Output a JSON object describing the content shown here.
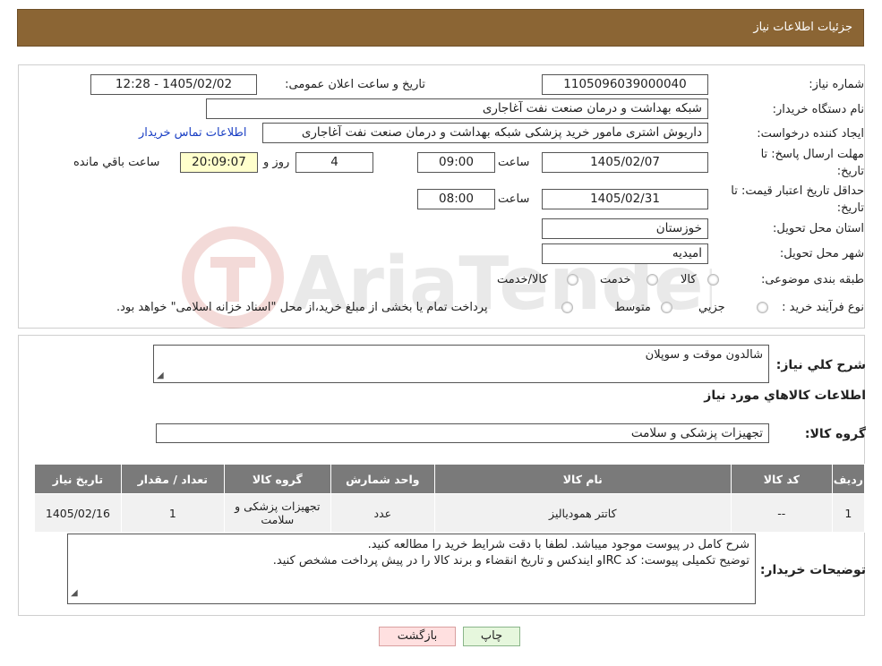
{
  "header": {
    "title": "جزئیات اطلاعات نیاز"
  },
  "fields": {
    "need_number_label": "شماره نیاز:",
    "need_number": "1105096039000040",
    "announce_label": "تاریخ و ساعت اعلان عمومی:",
    "announce_value": "1405/02/02 - 12:28",
    "buyer_org_label": "نام دستگاه خریدار:",
    "buyer_org": "شبکه بهداشت و درمان صنعت نفت آغاجاری",
    "requester_label": "ایجاد کننده درخواست:",
    "requester": "داریوش اشتری مامور خرید پزشکی شبکه بهداشت و درمان صنعت نفت آغاجاری",
    "contact_link": "اطلاعات تماس خریدار",
    "deadline_label_1": "مهلت ارسال پاسخ: تا",
    "deadline_label_2": "تاریخ:",
    "deadline_date": "1405/02/07",
    "time_label": "ساعت",
    "deadline_time": "09:00",
    "days_value": "4",
    "days_label": "روز و",
    "remaining_time": "20:09:07",
    "remaining_label": "ساعت باقي مانده",
    "price_validity_label_1": "حداقل تاریخ اعتبار قیمت: تا",
    "price_validity_label_2": "تاریخ:",
    "price_validity_date": "1405/02/31",
    "price_validity_time": "08:00",
    "province_label": "استان محل تحویل:",
    "province": "خوزستان",
    "city_label": "شهر محل تحویل:",
    "city": "امیدیه",
    "category_label": "طبقه بندی موضوعی:",
    "category_options": [
      "کالا",
      "خدمت",
      "کالا/خدمت"
    ],
    "process_label": "نوع فرآیند خرید :",
    "process_options": [
      "جزیي",
      "متوسط"
    ],
    "process_note": "پرداخت تمام یا بخشی از مبلغ خرید،از محل \"اسناد خزانه اسلامی\" خواهد بود."
  },
  "summary": {
    "label": "شرح کلي نیاز:",
    "value": "شالدون موقت و سوپلان",
    "goods_info_title": "اطلاعات کالاهاي مورد نیاز",
    "group_label": "گروه کالا:",
    "group_value": "تجهیزات پزشکی و سلامت"
  },
  "table": {
    "headers": [
      "ردیف",
      "کد کالا",
      "نام کالا",
      "واحد شمارش",
      "گروه کالا",
      "تعداد / مقدار",
      "تاریخ نیاز"
    ],
    "rows": [
      [
        "1",
        "--",
        "کاتتر همودیالیز",
        "عدد",
        "تجهیزات پزشکی و سلامت",
        "1",
        "1405/02/16"
      ]
    ]
  },
  "buyer_notes": {
    "label": "توضیحات خریدار:",
    "line1": "شرح کامل در پیوست موجود میباشد. لطفا با دقت شرایط خرید را مطالعه کنید.",
    "line2": "توضیح تکمیلی پیوست: کد IRCو ایندکس و تاریخ انقضاء و برند کالا را در پیش پرداخت مشخص کنید."
  },
  "buttons": {
    "print": "چاپ",
    "back": "بازگشت"
  },
  "watermark_text": "AriaTender.neT",
  "colors": {
    "header_bg": "#8b6534",
    "table_header": "#7a7a7a",
    "print_btn": "#e6f7dd",
    "back_btn": "#ffe0e0",
    "link": "#1a3fc4"
  }
}
